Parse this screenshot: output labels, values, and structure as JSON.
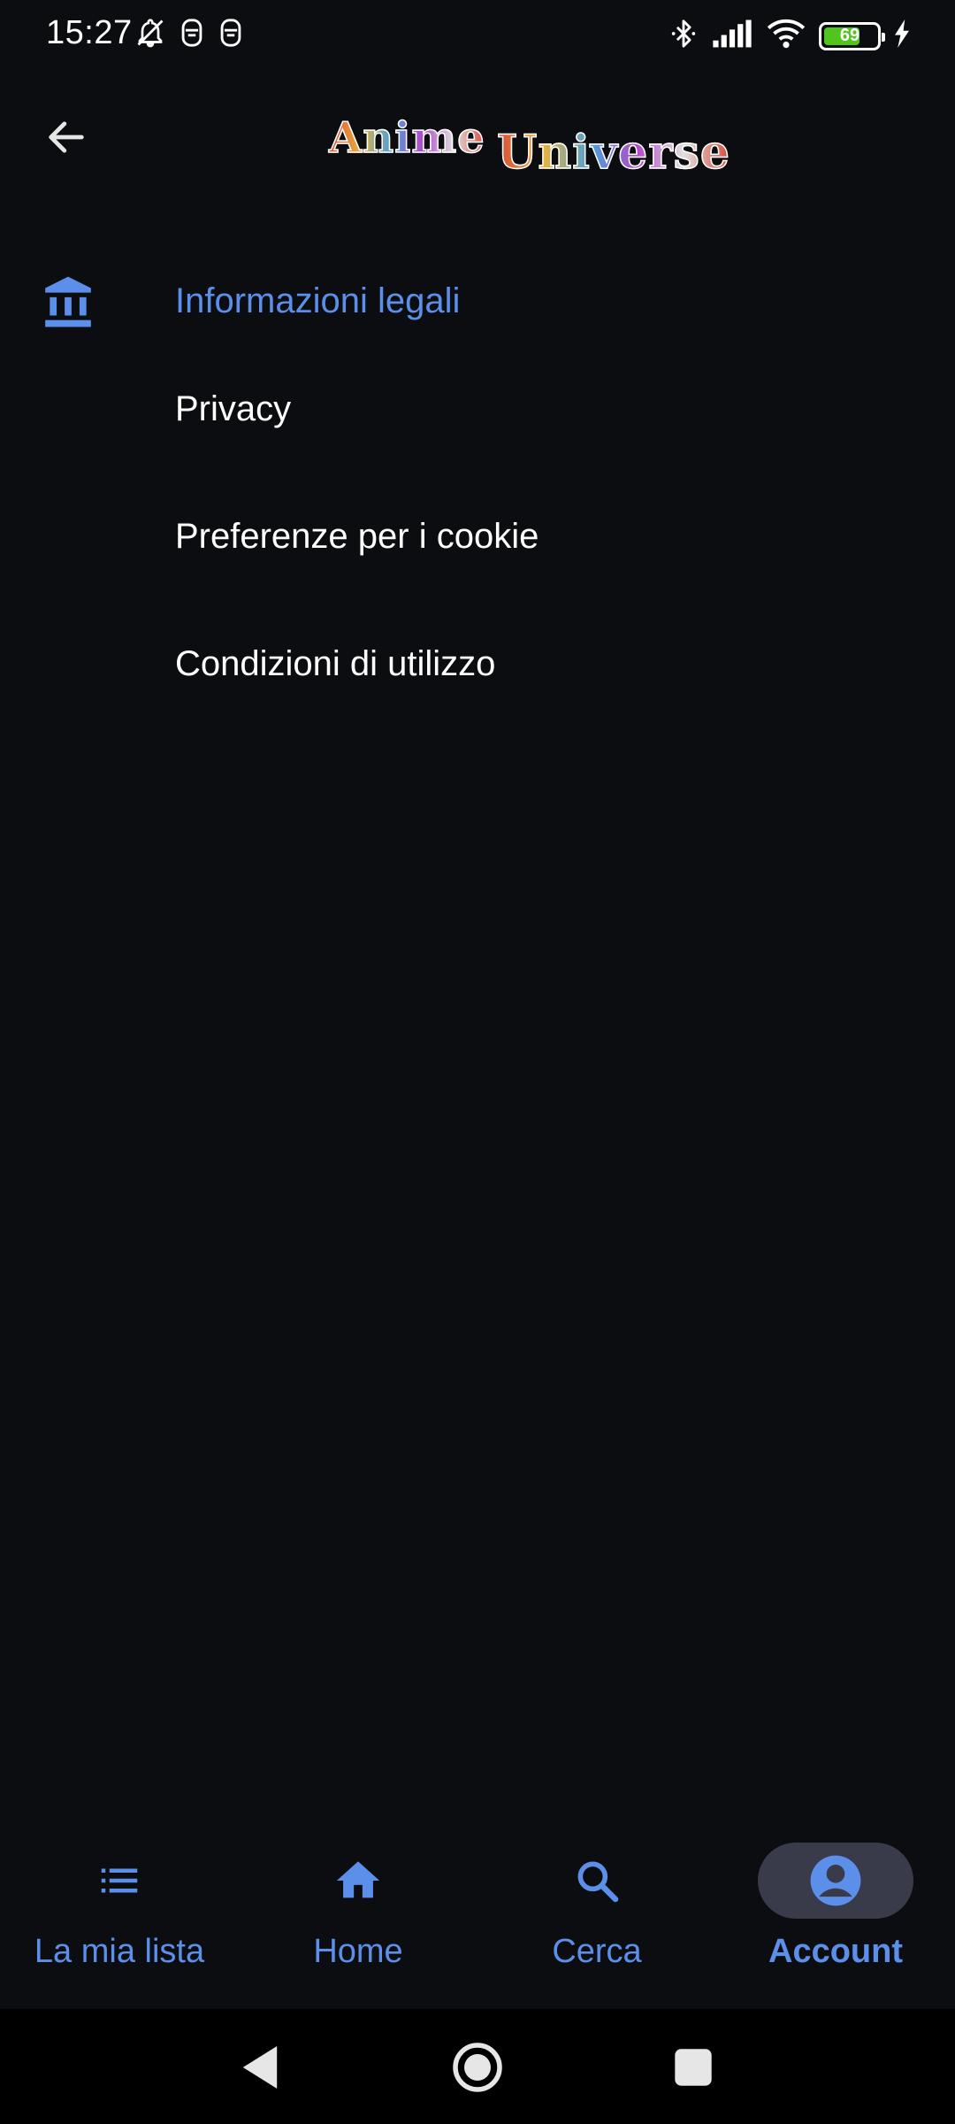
{
  "status_bar": {
    "time": "15:27",
    "left_icons": [
      "bell-off-icon",
      "notification-app-icon",
      "notification-app-icon"
    ],
    "right_icons": [
      "bluetooth-icon",
      "signal-icon",
      "wifi-icon"
    ],
    "battery_level": 69,
    "battery_text": "69",
    "charging": true
  },
  "header": {
    "back_icon": "arrow-left-icon",
    "logo_part1": "Anime",
    "logo_part2": "Universe"
  },
  "section": {
    "icon": "bank-icon",
    "title": "Informazioni legali",
    "items": [
      {
        "label": "Privacy"
      },
      {
        "label": "Preferenze per i cookie"
      },
      {
        "label": "Condizioni di utilizzo"
      }
    ]
  },
  "bottom_nav": {
    "items": [
      {
        "label": "La mia lista",
        "icon": "list-icon",
        "active": false
      },
      {
        "label": "Home",
        "icon": "home-icon",
        "active": false
      },
      {
        "label": "Cerca",
        "icon": "search-icon",
        "active": false
      },
      {
        "label": "Account",
        "icon": "account-circle-icon",
        "active": true
      }
    ]
  },
  "colors": {
    "background": "#0b0d10",
    "accent": "#5b8fea",
    "active_pill": "#3a3b4a",
    "battery_green": "#4fc51e"
  }
}
